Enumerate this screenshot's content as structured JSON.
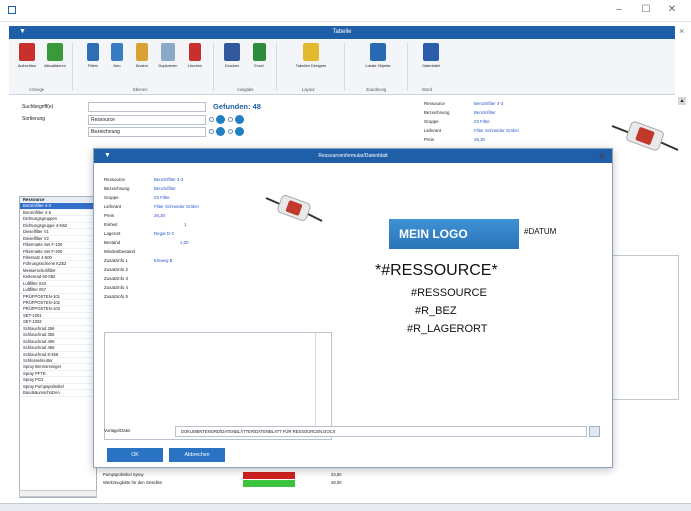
{
  "window": {
    "min": "–",
    "max": "☐",
    "close": "✕"
  },
  "ribbon": {
    "title": "Tabelle",
    "buttons": [
      {
        "label": "Aufrechten",
        "color": "#c9302c"
      },
      {
        "label": "Aktualisieren",
        "color": "#3a9a3a"
      },
      {
        "label": "Filtern",
        "color": "#2f6db5"
      },
      {
        "label": "Neu",
        "color": "#3a7cc2"
      },
      {
        "label": "Ändern",
        "color": "#d7a233"
      },
      {
        "label": "Duplizieren",
        "color": "#8aa9c9"
      },
      {
        "label": "Löschen",
        "color": "#c9302c"
      },
      {
        "label": "Drucken",
        "color": "#33599c"
      },
      {
        "label": "Excel",
        "color": "#2e8b3a"
      },
      {
        "label": "Tabellen Designer",
        "color": "#e3b92f"
      },
      {
        "label": "Lokale Objekte",
        "color": "#2a6ab3"
      },
      {
        "label": "Datenblatt",
        "color": "#2a5daa"
      }
    ],
    "groups": [
      "Anzeige",
      "Ebenen",
      "Ausgabe",
      "Layout",
      "Zuordnung",
      "Word"
    ]
  },
  "form": {
    "search_label": "Suchbegriff(e)",
    "sort_label": "Sortierung",
    "sort1": "Ressource",
    "sort2": "Bezeichnung",
    "found": "Gefunden: 48"
  },
  "details": {
    "labels": [
      "Ressource",
      "Bezeichnung",
      "Gruppe",
      "Lieferant",
      "Preis"
    ],
    "values": [
      "Benzinfilter 4-3",
      "Benzinfilter",
      "03 Filter",
      "Filter Schneider GmbH",
      "26,30"
    ]
  },
  "list": {
    "header": "Ressource",
    "items": [
      "Benzinfilter 4-3",
      "Benzinfilter 4-5",
      "Dichtungsgruppen",
      "Dichtungsgruppe 4-N52",
      "Dieselfilter V1",
      "Dieselfilter V2",
      "Filtermatte Set F-100",
      "Filtermatte Set F-200",
      "Filtersatz 4-500",
      "Führungsschiene KZ52",
      "Messerschuhfilter",
      "Kettenrad 60-062",
      "Luftfilter 042",
      "Luftfilter 057",
      "PRÜFPOSTEN-101",
      "PRÜFPOSTEN-102",
      "PRÜFPOSTEN-103",
      "SET-1001",
      "SET-1002",
      "Schlauchrad 256",
      "Schlauchrad 306",
      "Schlauchrad 406",
      "Schlauchrad 456",
      "Schlauchrad 8-356",
      "Schlüsselmutter",
      "Spray Bremsreiniger",
      "Spray PFTE",
      "Spray PG2",
      "Spray Pumpspülmittel",
      "Bandsäumschützen"
    ]
  },
  "bottom": {
    "row1_label": "Pumpspülmittel Spray",
    "row1_val": "33,60",
    "row2_label": "Werkzeugkiste für den Gesellen",
    "row2_val": "48,00"
  },
  "modal": {
    "title": "Ressourcenformular/Datenblatt",
    "labels": [
      "Ressource",
      "Bezeichnung",
      "Gruppe",
      "Lieferant",
      "Preis",
      "Einheit",
      "Lagerort",
      "Bestand",
      "Mindestbestand",
      "Zusatzinfo 1",
      "Zusatzinfo 2",
      "Zusatzinfo 3",
      "Zusatzinfo 4",
      "Zusatzinfo 5"
    ],
    "values": [
      "Benzinfilter 4-3",
      "Benzinfilter",
      "03 Filter",
      "Filter Schneider GmbH",
      "26,30",
      "1",
      "Regal D-3",
      "1,00",
      "",
      "Einweg B",
      "",
      "",
      "",
      ""
    ],
    "logo": "MEIN LOGO",
    "datum": "#DATUM",
    "ressource_big": "*#RESSOURCE*",
    "ressource": "#RESSOURCE",
    "bez": "#R_BEZ",
    "lagerort": "#R_LAGERORT",
    "file_label": "Vorlage/Datei",
    "file_path": "DOKUMENTENORD\\DATENBLÄTTER\\DATENBLATT FÜR RESSOURCEN.DOCX",
    "ok": "OK",
    "cancel": "Abbrechen"
  }
}
